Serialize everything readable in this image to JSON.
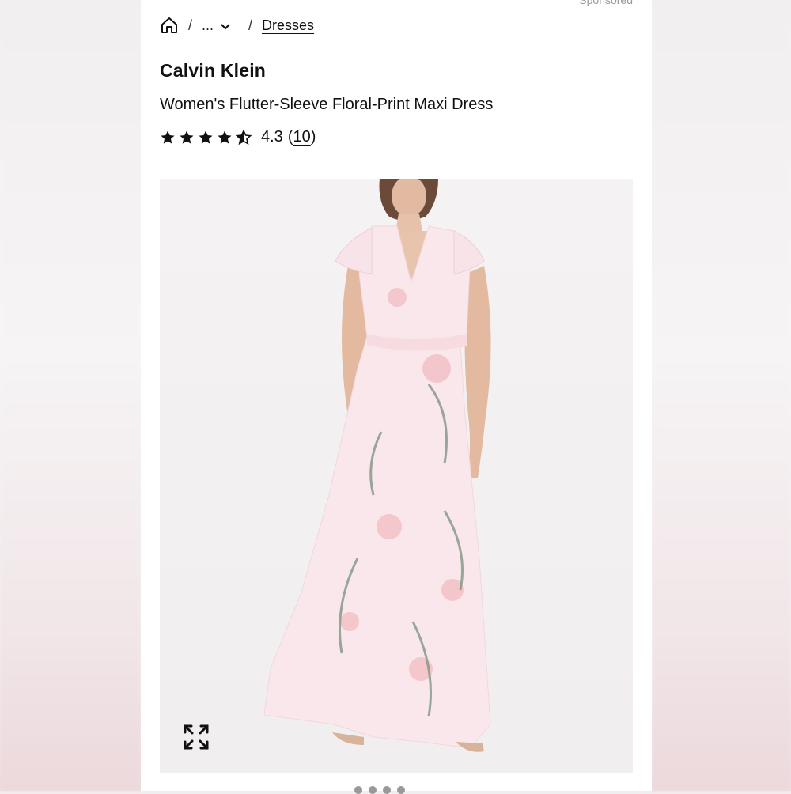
{
  "header": {
    "sponsored_label": "Sponsored"
  },
  "breadcrumb": {
    "home_icon": "home-icon",
    "separator": "/",
    "ellipsis": "...",
    "current": "Dresses"
  },
  "product": {
    "brand": "Calvin Klein",
    "title": "Women's Flutter-Sleeve Floral-Print Maxi Dress",
    "rating_value": "4.3",
    "rating_open": "(",
    "review_count": "10",
    "rating_close": ")",
    "stars_filled": 4.5,
    "stars_total": 5
  },
  "image": {
    "expand_icon": "expand-icon",
    "accent_pink": "#f2c3c8",
    "leaf_green": "#7f9583"
  }
}
